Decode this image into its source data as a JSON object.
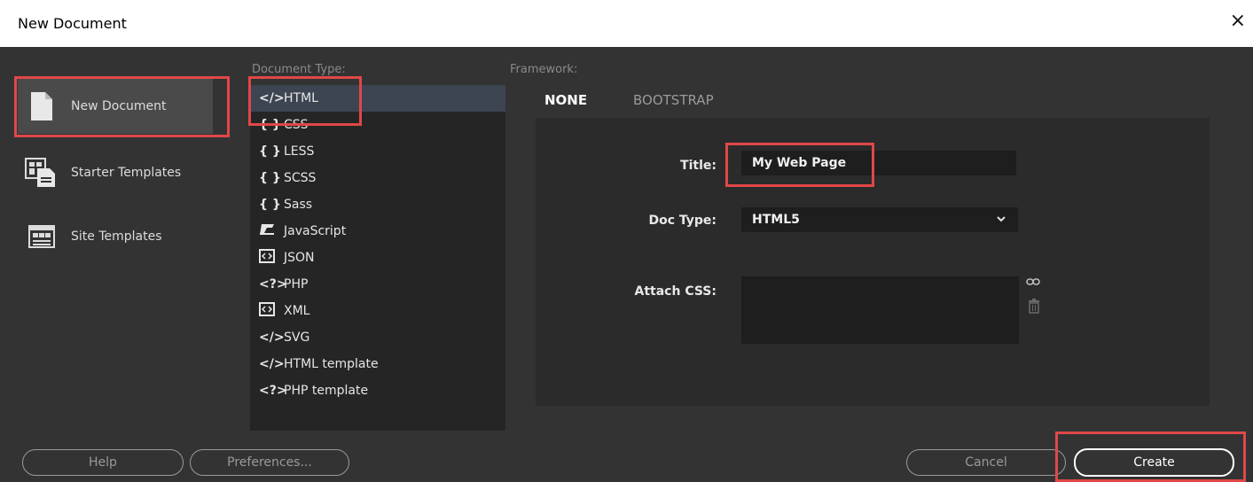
{
  "window": {
    "title": "New Document",
    "close_icon": "×"
  },
  "categories": [
    {
      "label": "New Document",
      "icon": "page-icon",
      "selected": true
    },
    {
      "label": "Starter Templates",
      "icon": "starter-templates-icon",
      "selected": false
    },
    {
      "label": "Site Templates",
      "icon": "site-templates-icon",
      "selected": false
    }
  ],
  "document_type": {
    "label": "Document Type:",
    "items": [
      {
        "glyph": "</>",
        "label": "HTML",
        "selected": true
      },
      {
        "glyph": "{ }",
        "label": "CSS"
      },
      {
        "glyph": "{ }",
        "label": "LESS"
      },
      {
        "glyph": "{ }",
        "label": "SCSS"
      },
      {
        "glyph": "{ }",
        "label": "Sass"
      },
      {
        "glyph": "JS",
        "label": "JavaScript"
      },
      {
        "glyph": "<>",
        "label": "JSON"
      },
      {
        "glyph": "<?>",
        "label": "PHP"
      },
      {
        "glyph": "<>",
        "label": "XML"
      },
      {
        "glyph": "</>",
        "label": "SVG"
      },
      {
        "glyph": "</>",
        "label": "HTML template"
      },
      {
        "glyph": "<?>",
        "label": "PHP template"
      }
    ]
  },
  "framework": {
    "label": "Framework:",
    "tabs": [
      {
        "label": "NONE",
        "active": true
      },
      {
        "label": "BOOTSTRAP",
        "active": false
      }
    ],
    "fields": {
      "title_label": "Title:",
      "title_value": "My Web Page",
      "doctype_label": "Doc Type:",
      "doctype_value": "HTML5",
      "attach_label": "Attach CSS:"
    }
  },
  "buttons": {
    "help": "Help",
    "preferences": "Preferences...",
    "cancel": "Cancel",
    "create": "Create"
  },
  "colors": {
    "highlight": "#e04848",
    "dialog_bg": "#333333",
    "selection": "#3d4452"
  }
}
